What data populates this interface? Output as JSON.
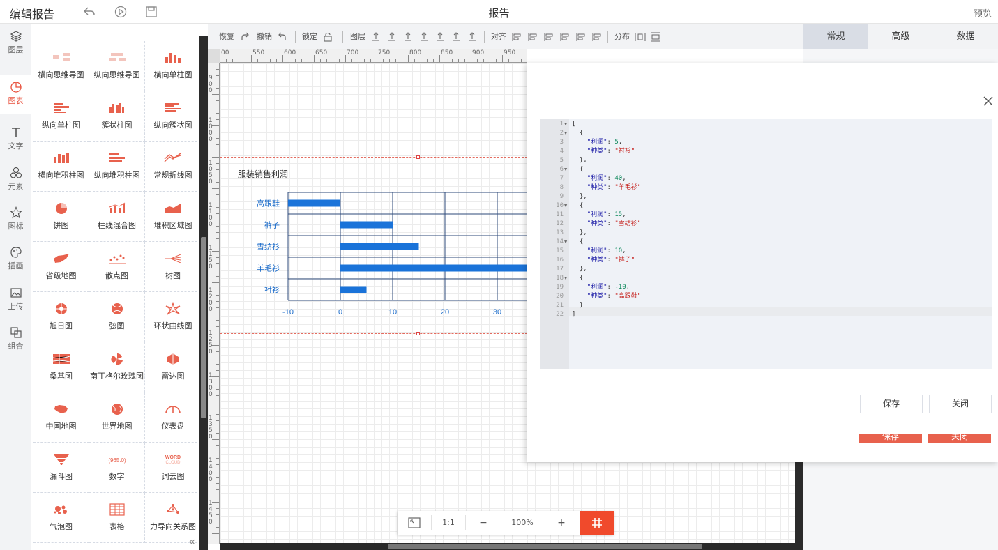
{
  "header": {
    "title": "编辑报告",
    "center_title": "报告",
    "preview_label": "预览"
  },
  "iconbar": {
    "items": [
      {
        "label": "图层",
        "icon": "layers-icon"
      },
      {
        "label": "图表",
        "icon": "chart-pie-icon"
      },
      {
        "label": "文字",
        "icon": "text-icon"
      },
      {
        "label": "元素",
        "icon": "shapes-icon"
      },
      {
        "label": "图标",
        "icon": "star-icon"
      },
      {
        "label": "插画",
        "icon": "palette-icon"
      },
      {
        "label": "上传",
        "icon": "upload-image-icon"
      },
      {
        "label": "组合",
        "icon": "combine-icon"
      }
    ]
  },
  "chart_types": [
    "横向思维导图",
    "纵向思维导图",
    "横向单柱图",
    "纵向单柱图",
    "簇状柱图",
    "纵向簇状图",
    "横向堆积柱图",
    "纵向堆积柱图",
    "常规折线图",
    "饼图",
    "柱线混合图",
    "堆积区域图",
    "省级地图",
    "散点图",
    "树图",
    "旭日图",
    "弦图",
    "环状曲线图",
    "桑基图",
    "南丁格尔玫瑰图",
    "雷达图",
    "中国地图",
    "世界地图",
    "仪表盘",
    "漏斗图",
    "数字",
    "词云图",
    "气泡图",
    "表格",
    "力导向关系图"
  ],
  "toolbar": {
    "redo": "恢复",
    "undo": "撤销",
    "lock": "锁定",
    "layer": "图层",
    "align": "对齐",
    "distribute": "分布"
  },
  "right_tabs": [
    "常规",
    "高级",
    "数据"
  ],
  "ruler": {
    "h_ticks": [
      "00",
      "550",
      "600",
      "650",
      "700",
      "750",
      "800",
      "850",
      "900",
      "950"
    ],
    "v_ticks": [
      "900",
      "1000",
      "1050",
      "1100",
      "1150",
      "1200",
      "1250",
      "1300",
      "1350",
      "1400",
      "1450"
    ]
  },
  "zoom": {
    "ratio_label": "1:1",
    "minus": "−",
    "level": "100%",
    "plus": "+"
  },
  "chart_data": {
    "type": "bar",
    "orientation": "horizontal",
    "title": "服装销售利润",
    "categories": [
      "高跟鞋",
      "裤子",
      "雪纺衫",
      "羊毛衫",
      "衬衫"
    ],
    "values": [
      -10,
      10,
      15,
      40,
      5
    ],
    "xlim": [
      -10,
      40
    ],
    "x_ticks": [
      "-10",
      "0",
      "10",
      "20",
      "30"
    ],
    "bar_color": "#1a73d9",
    "grid": true
  },
  "editor": {
    "lines": [
      {
        "t": "["
      },
      {
        "t": "  {"
      },
      {
        "t": "    \"利润\": 5,",
        "k": "\"利润\"",
        "v": "5"
      },
      {
        "t": "    \"种类\": \"衬衫\"",
        "k": "\"种类\"",
        "v": "\"衬衫\""
      },
      {
        "t": "  },"
      },
      {
        "t": "  {"
      },
      {
        "t": "    \"利润\": 40,",
        "k": "\"利润\"",
        "v": "40"
      },
      {
        "t": "    \"种类\": \"羊毛衫\"",
        "k": "\"种类\"",
        "v": "\"羊毛衫\""
      },
      {
        "t": "  },"
      },
      {
        "t": "  {"
      },
      {
        "t": "    \"利润\": 15,",
        "k": "\"利润\"",
        "v": "15"
      },
      {
        "t": "    \"种类\": \"雪纺衫\"",
        "k": "\"种类\"",
        "v": "\"雪纺衫\""
      },
      {
        "t": "  },"
      },
      {
        "t": "  {"
      },
      {
        "t": "    \"利润\": 10,",
        "k": "\"利润\"",
        "v": "10"
      },
      {
        "t": "    \"种类\": \"裤子\"",
        "k": "\"种类\"",
        "v": "\"裤子\""
      },
      {
        "t": "  },"
      },
      {
        "t": "  {"
      },
      {
        "t": "    \"利润\": -10,",
        "k": "\"利润\"",
        "v": "-10"
      },
      {
        "t": "    \"种类\": \"高跟鞋\"",
        "k": "\"种类\"",
        "v": "\"高跟鞋\""
      },
      {
        "t": "  }"
      },
      {
        "t": "]"
      }
    ],
    "fold_lines": [
      1,
      2,
      6,
      10,
      14,
      18
    ]
  },
  "modal": {
    "save_label": "保存",
    "close_label": "关闭"
  },
  "colors": {
    "accent": "#e8513d",
    "bar": "#1a73d9"
  }
}
